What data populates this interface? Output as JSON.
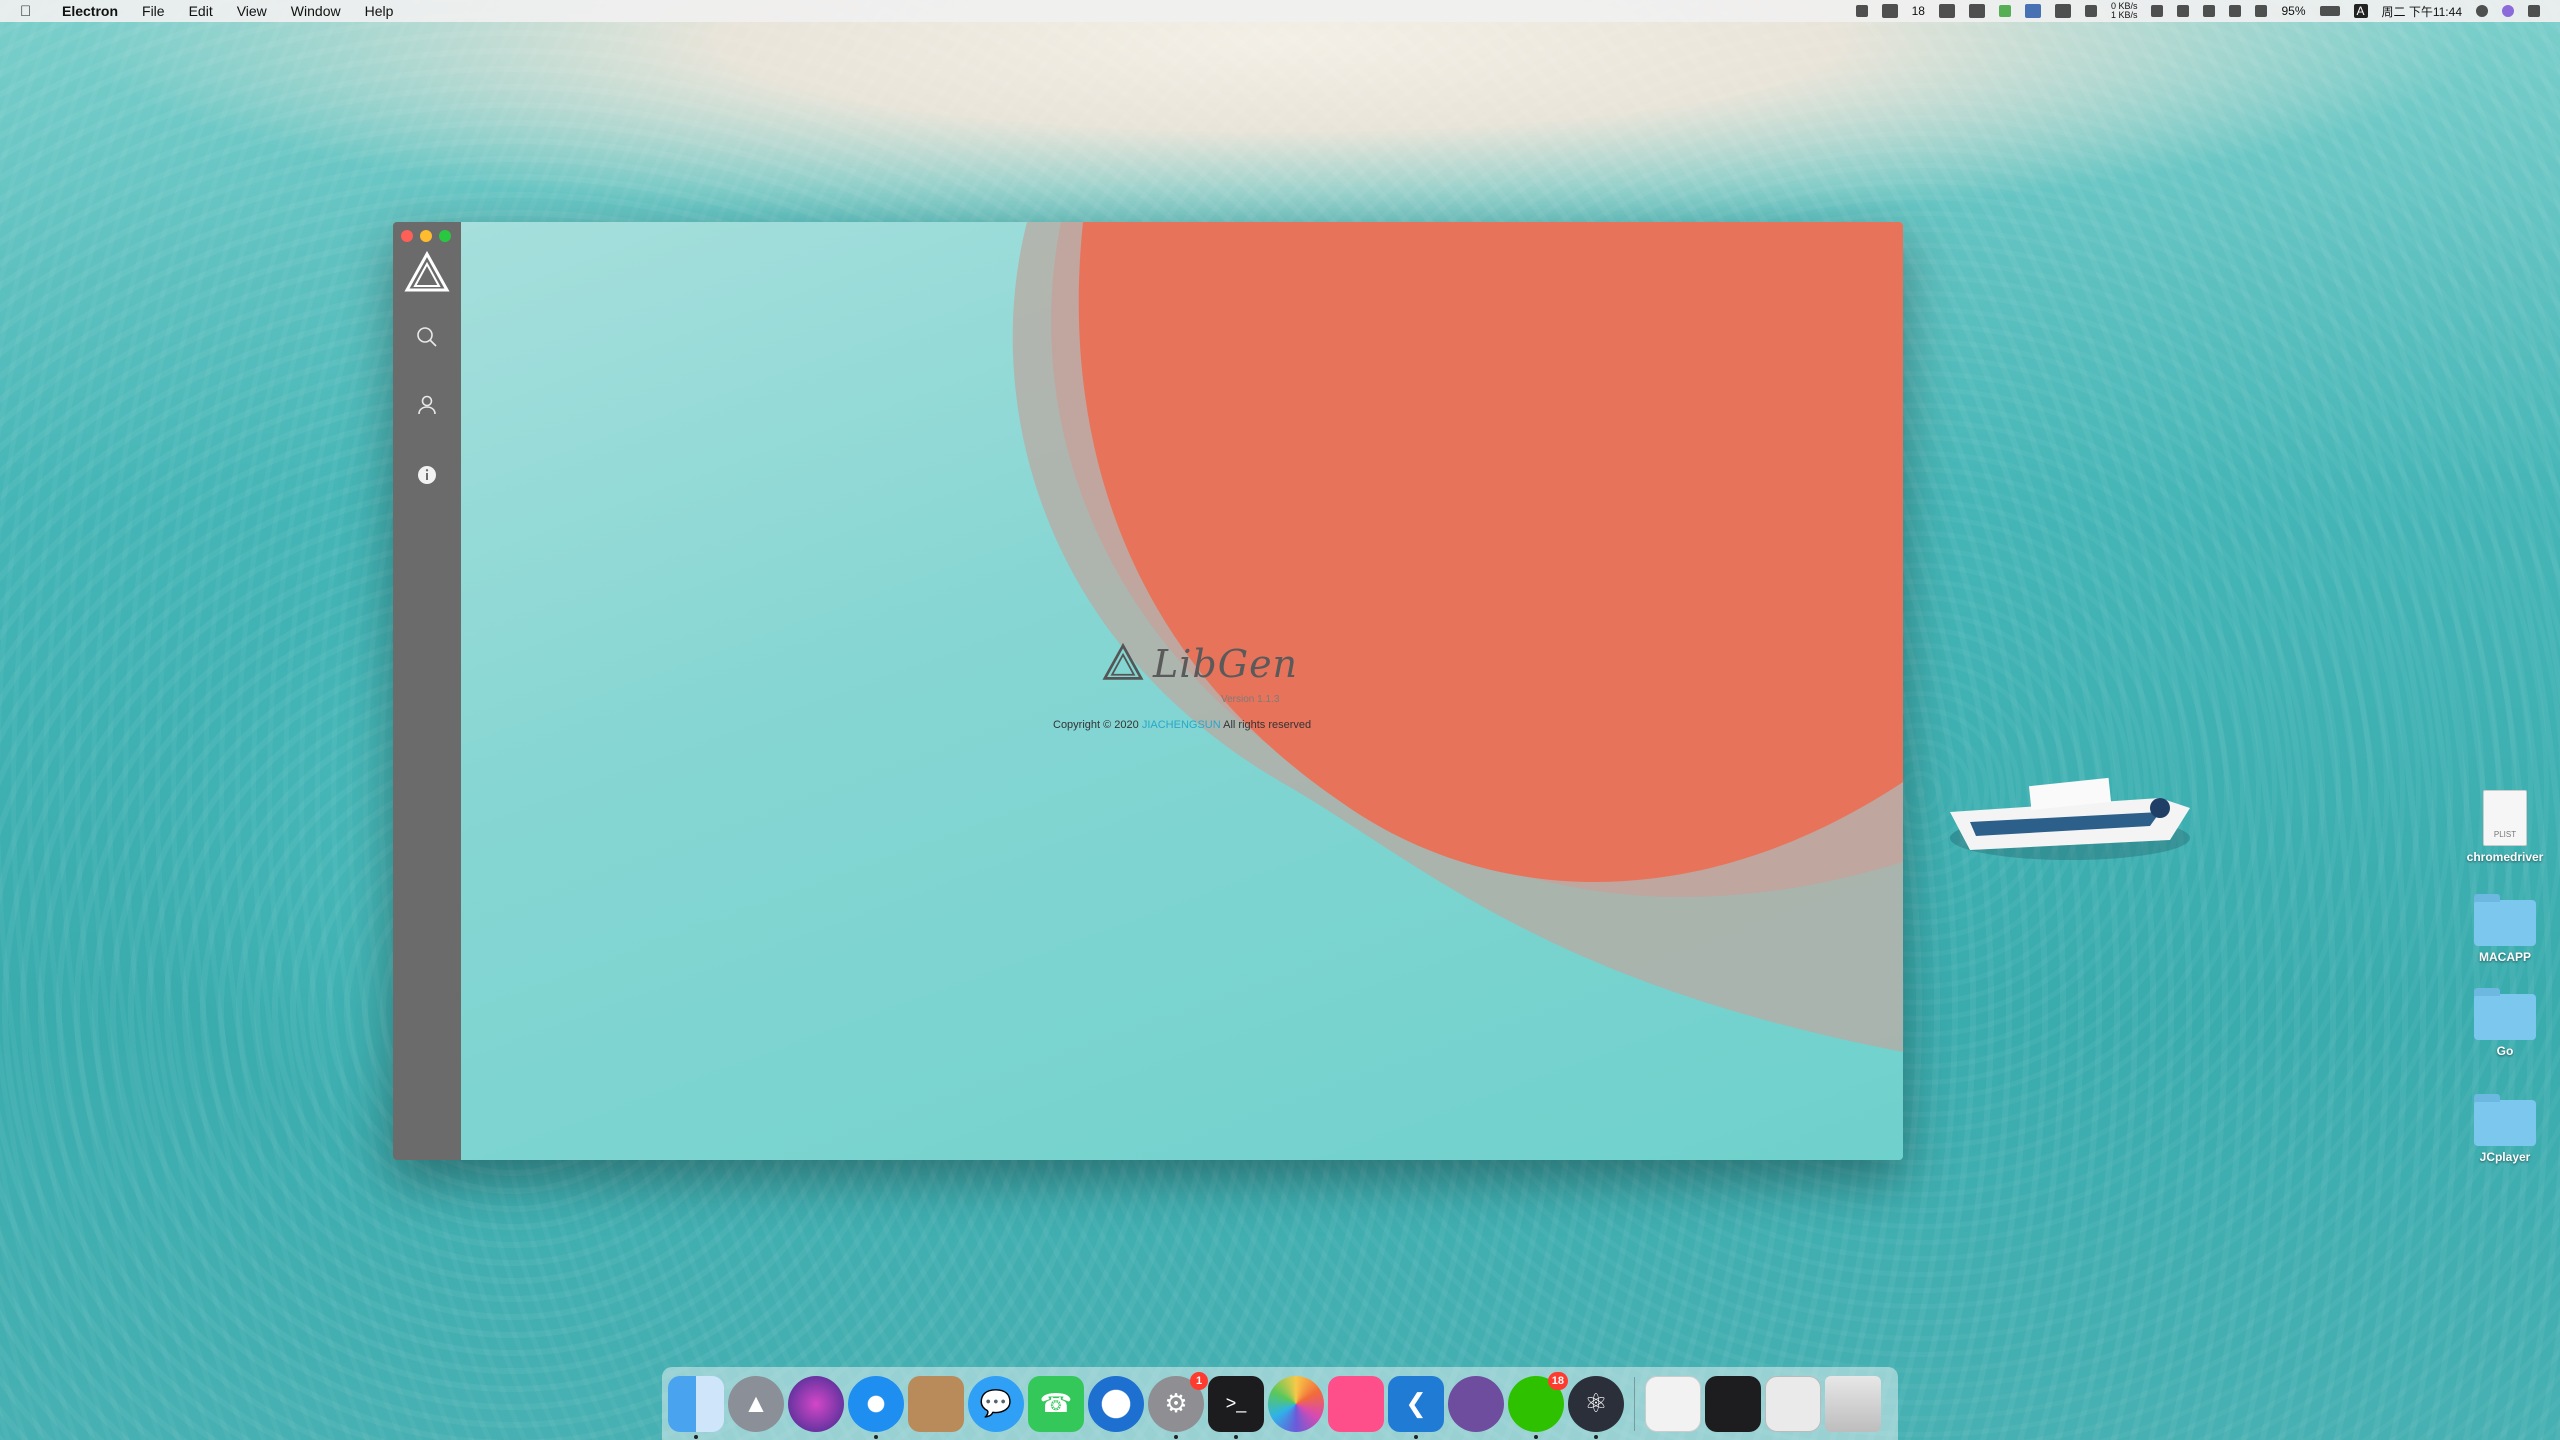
{
  "menubar": {
    "app_name": "Electron",
    "menus": [
      "File",
      "Edit",
      "View",
      "Window",
      "Help"
    ],
    "wechat_count": "18",
    "net_up": "0 KB/s",
    "net_down": "1 KB/s",
    "battery": "95%",
    "input_method": "A",
    "datetime": "周二 下午11:44"
  },
  "window": {
    "sidebar": {
      "icons": [
        "libgen-logo-icon",
        "search-icon",
        "user-icon",
        "info-icon"
      ]
    },
    "splash": {
      "title": "LibGen",
      "version": "Version 1.1.3",
      "copyright_prefix": "Copyright © 2020",
      "author": "JIACHENGSUN",
      "copyright_suffix": "All rights reserved"
    },
    "colors": {
      "sidebar": "#6b6b6b",
      "teal": "#7dd6d1",
      "coral": "#e8735b"
    }
  },
  "desktop_icons": [
    {
      "label": "chromedriver",
      "type": "file",
      "tag": "PLIST"
    },
    {
      "label": "MACAPP",
      "type": "folder"
    },
    {
      "label": "Go",
      "type": "folder"
    },
    {
      "label": "JCplayer",
      "type": "folder"
    }
  ],
  "dock": {
    "badges": {
      "system-preferences": "1",
      "wechat": "18"
    }
  }
}
